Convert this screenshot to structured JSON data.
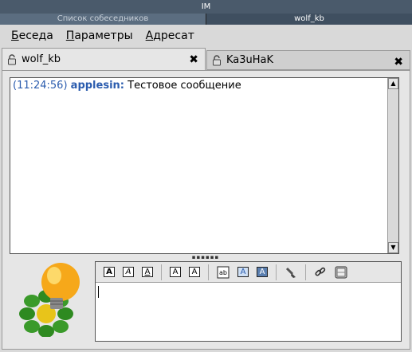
{
  "window": {
    "title": "IM"
  },
  "window_tabs": [
    {
      "label": "Список собеседников",
      "active": false
    },
    {
      "label": "wolf_kb",
      "active": true
    }
  ],
  "menu": [
    {
      "label": "Беседа",
      "mnemonic": "Б",
      "rest": "еседа"
    },
    {
      "label": "Параметры",
      "mnemonic": "П",
      "rest": "араметры"
    },
    {
      "label": "Адресат",
      "mnemonic": "А",
      "rest": "дресат"
    }
  ],
  "chat_tabs": [
    {
      "label": "wolf_kb",
      "active": true,
      "close": "✖"
    },
    {
      "label": "Ka3uHaK",
      "active": false,
      "close": "✖"
    }
  ],
  "log": {
    "messages": [
      {
        "time": "(11:24:56)",
        "nick": "applesin:",
        "text": "Тестовое сообщение"
      }
    ]
  },
  "toolbar": {
    "bold": "A",
    "italic": "A",
    "underline": "A",
    "grow": "A",
    "shrink": "A",
    "bgcolor": "A",
    "fgcolor": "A"
  },
  "input": {
    "value": ""
  },
  "colors": {
    "time": "#2b5cae",
    "nick": "#2b5cae",
    "titlebar": "#4a5a6b"
  }
}
